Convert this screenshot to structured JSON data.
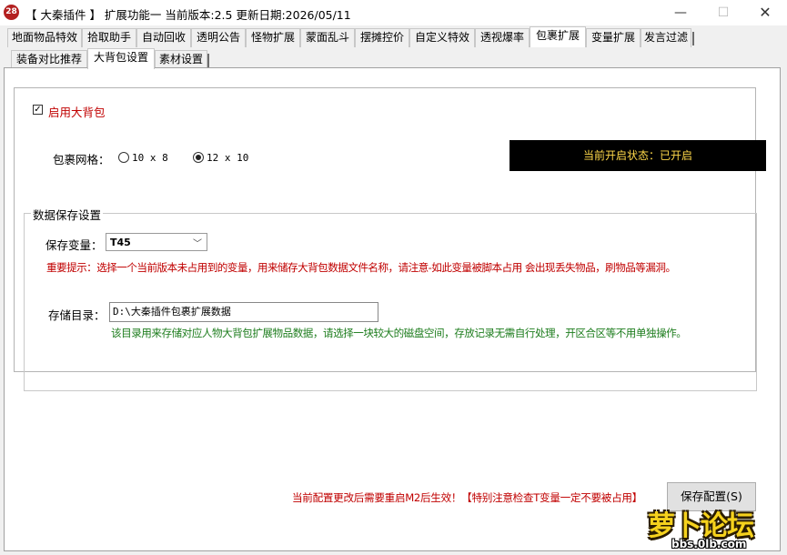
{
  "window": {
    "title": "【 大秦插件 】 扩展功能一 当前版本:2.5 更新日期:2026/05/11",
    "icon_text": "28",
    "icon_color": "#b32020",
    "minimize_glyph": "—",
    "maximize_glyph": "☐",
    "close_glyph": "✕"
  },
  "main_tabs": [
    {
      "label": "地面物品特效"
    },
    {
      "label": "拾取助手"
    },
    {
      "label": "自动回收"
    },
    {
      "label": "透明公告"
    },
    {
      "label": "怪物扩展"
    },
    {
      "label": "蒙面乱斗"
    },
    {
      "label": "摆摊控价"
    },
    {
      "label": "自定义特效"
    },
    {
      "label": "透视爆率"
    },
    {
      "label": "包裹扩展",
      "active": true
    },
    {
      "label": "变量扩展"
    },
    {
      "label": "发言过滤"
    }
  ],
  "sub_tabs": [
    {
      "label": "装备对比推荐"
    },
    {
      "label": "大背包设置",
      "active": true
    },
    {
      "label": "素材设置"
    }
  ],
  "settings": {
    "enable_checkbox": {
      "label": "启用大背包",
      "checked": true,
      "mark": "✓"
    },
    "status": {
      "text": "当前开启状态：已开启",
      "bg_color": "#000000",
      "text_color": "#ffd94a"
    },
    "grid": {
      "label": "包裹网格：",
      "options": [
        {
          "label": "10 x 8",
          "checked": false
        },
        {
          "label": "12 x 10",
          "checked": true
        }
      ]
    }
  },
  "data_save": {
    "group_title": "数据保存设置",
    "variable_label": "保存变量：",
    "variable_value": "T45",
    "dropdown_glyph": "﹀",
    "warning": "重要提示：选择一个当前版本未占用到的变量，用来储存大背包数据文件名称，请注意-如此变量被脚本占用 会出现丢失物品，刷物品等漏洞。",
    "dir_label": "存储目录：",
    "dir_value": "D:\\大秦插件包裹扩展数据",
    "dir_hint": "该目录用来存储对应人物大背包扩展物品数据，请选择一块较大的磁盘空间，存放记录无需自行处理，开区合区等不用单独操作。"
  },
  "footer": {
    "notice": "当前配置更改后需要重启M2后生效！【特别注意检查T变量一定不要被占用】",
    "save_button": "保存配置(S)"
  },
  "watermark": {
    "logo_text": "萝卜论坛",
    "url": "bbs.0lb.com"
  }
}
